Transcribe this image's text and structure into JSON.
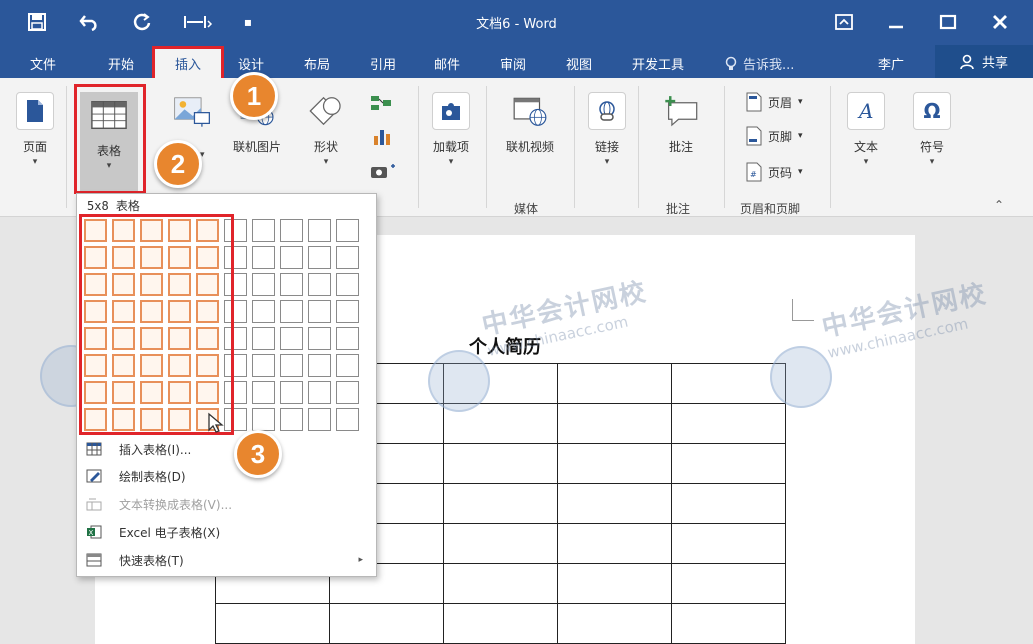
{
  "window": {
    "title": "文档6 - Word"
  },
  "menu": {
    "tabs": [
      "文件",
      "开始",
      "插入",
      "设计",
      "布局",
      "引用",
      "邮件",
      "审阅",
      "视图",
      "开发工具"
    ],
    "tell_me": "告诉我...",
    "user": "李广",
    "share": "共享"
  },
  "ribbon": {
    "pages": "页面",
    "table": "表格",
    "online_pictures": "联机图片",
    "shapes": "形状",
    "addins": "加载项",
    "online_video": "联机视频",
    "link": "链接",
    "comment": "批注",
    "header": "页眉",
    "footer": "页脚",
    "page_number": "页码",
    "text": "文本",
    "symbols": "符号",
    "groups": {
      "media": "媒体",
      "comments": "批注",
      "header_footer": "页眉和页脚"
    }
  },
  "table_menu": {
    "grid_label": "5x8 表格",
    "grid_selected_cols": 5,
    "grid_selected_rows": 8,
    "items": [
      {
        "label": "插入表格(I)...",
        "enabled": true
      },
      {
        "label": "绘制表格(D)",
        "enabled": true
      },
      {
        "label": "文本转换成表格(V)...",
        "enabled": false
      },
      {
        "label": "Excel 电子表格(X)",
        "enabled": true
      },
      {
        "label": "快速表格(T)",
        "enabled": true
      }
    ]
  },
  "document": {
    "title": "个人简历"
  },
  "watermark": {
    "name": "中华会计网校",
    "url": "www.chinaacc.com"
  },
  "callouts": [
    "1",
    "2",
    "3"
  ],
  "colors": {
    "word_blue": "#2b579a",
    "highlight_red": "#e0242a",
    "callout_orange": "#e8862e"
  }
}
